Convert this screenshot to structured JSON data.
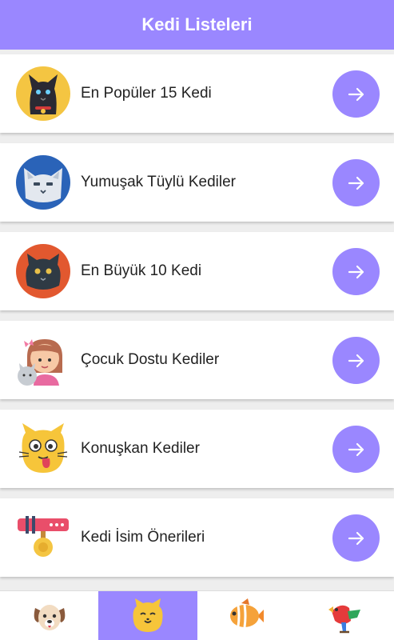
{
  "appbar": {
    "title": "Kedi Listeleri",
    "color": "#9a87ff"
  },
  "lists": [
    {
      "label": "En Popüler 15 Kedi",
      "icon": "black-cat-icon"
    },
    {
      "label": "Yumuşak Tüylü Kediler",
      "icon": "fluffy-cat-icon"
    },
    {
      "label": "En Büyük 10 Kedi",
      "icon": "big-cat-icon"
    },
    {
      "label": "Çocuk Dostu Kediler",
      "icon": "girl-with-cat-icon"
    },
    {
      "label": "Konuşkan Kediler",
      "icon": "talking-cat-icon"
    },
    {
      "label": "Kedi İsim Önerileri",
      "icon": "cat-collar-icon"
    }
  ],
  "bottom_nav": [
    {
      "icon": "dog-icon",
      "active": false
    },
    {
      "icon": "cat-icon",
      "active": true
    },
    {
      "icon": "fish-icon",
      "active": false
    },
    {
      "icon": "bird-icon",
      "active": false
    }
  ]
}
